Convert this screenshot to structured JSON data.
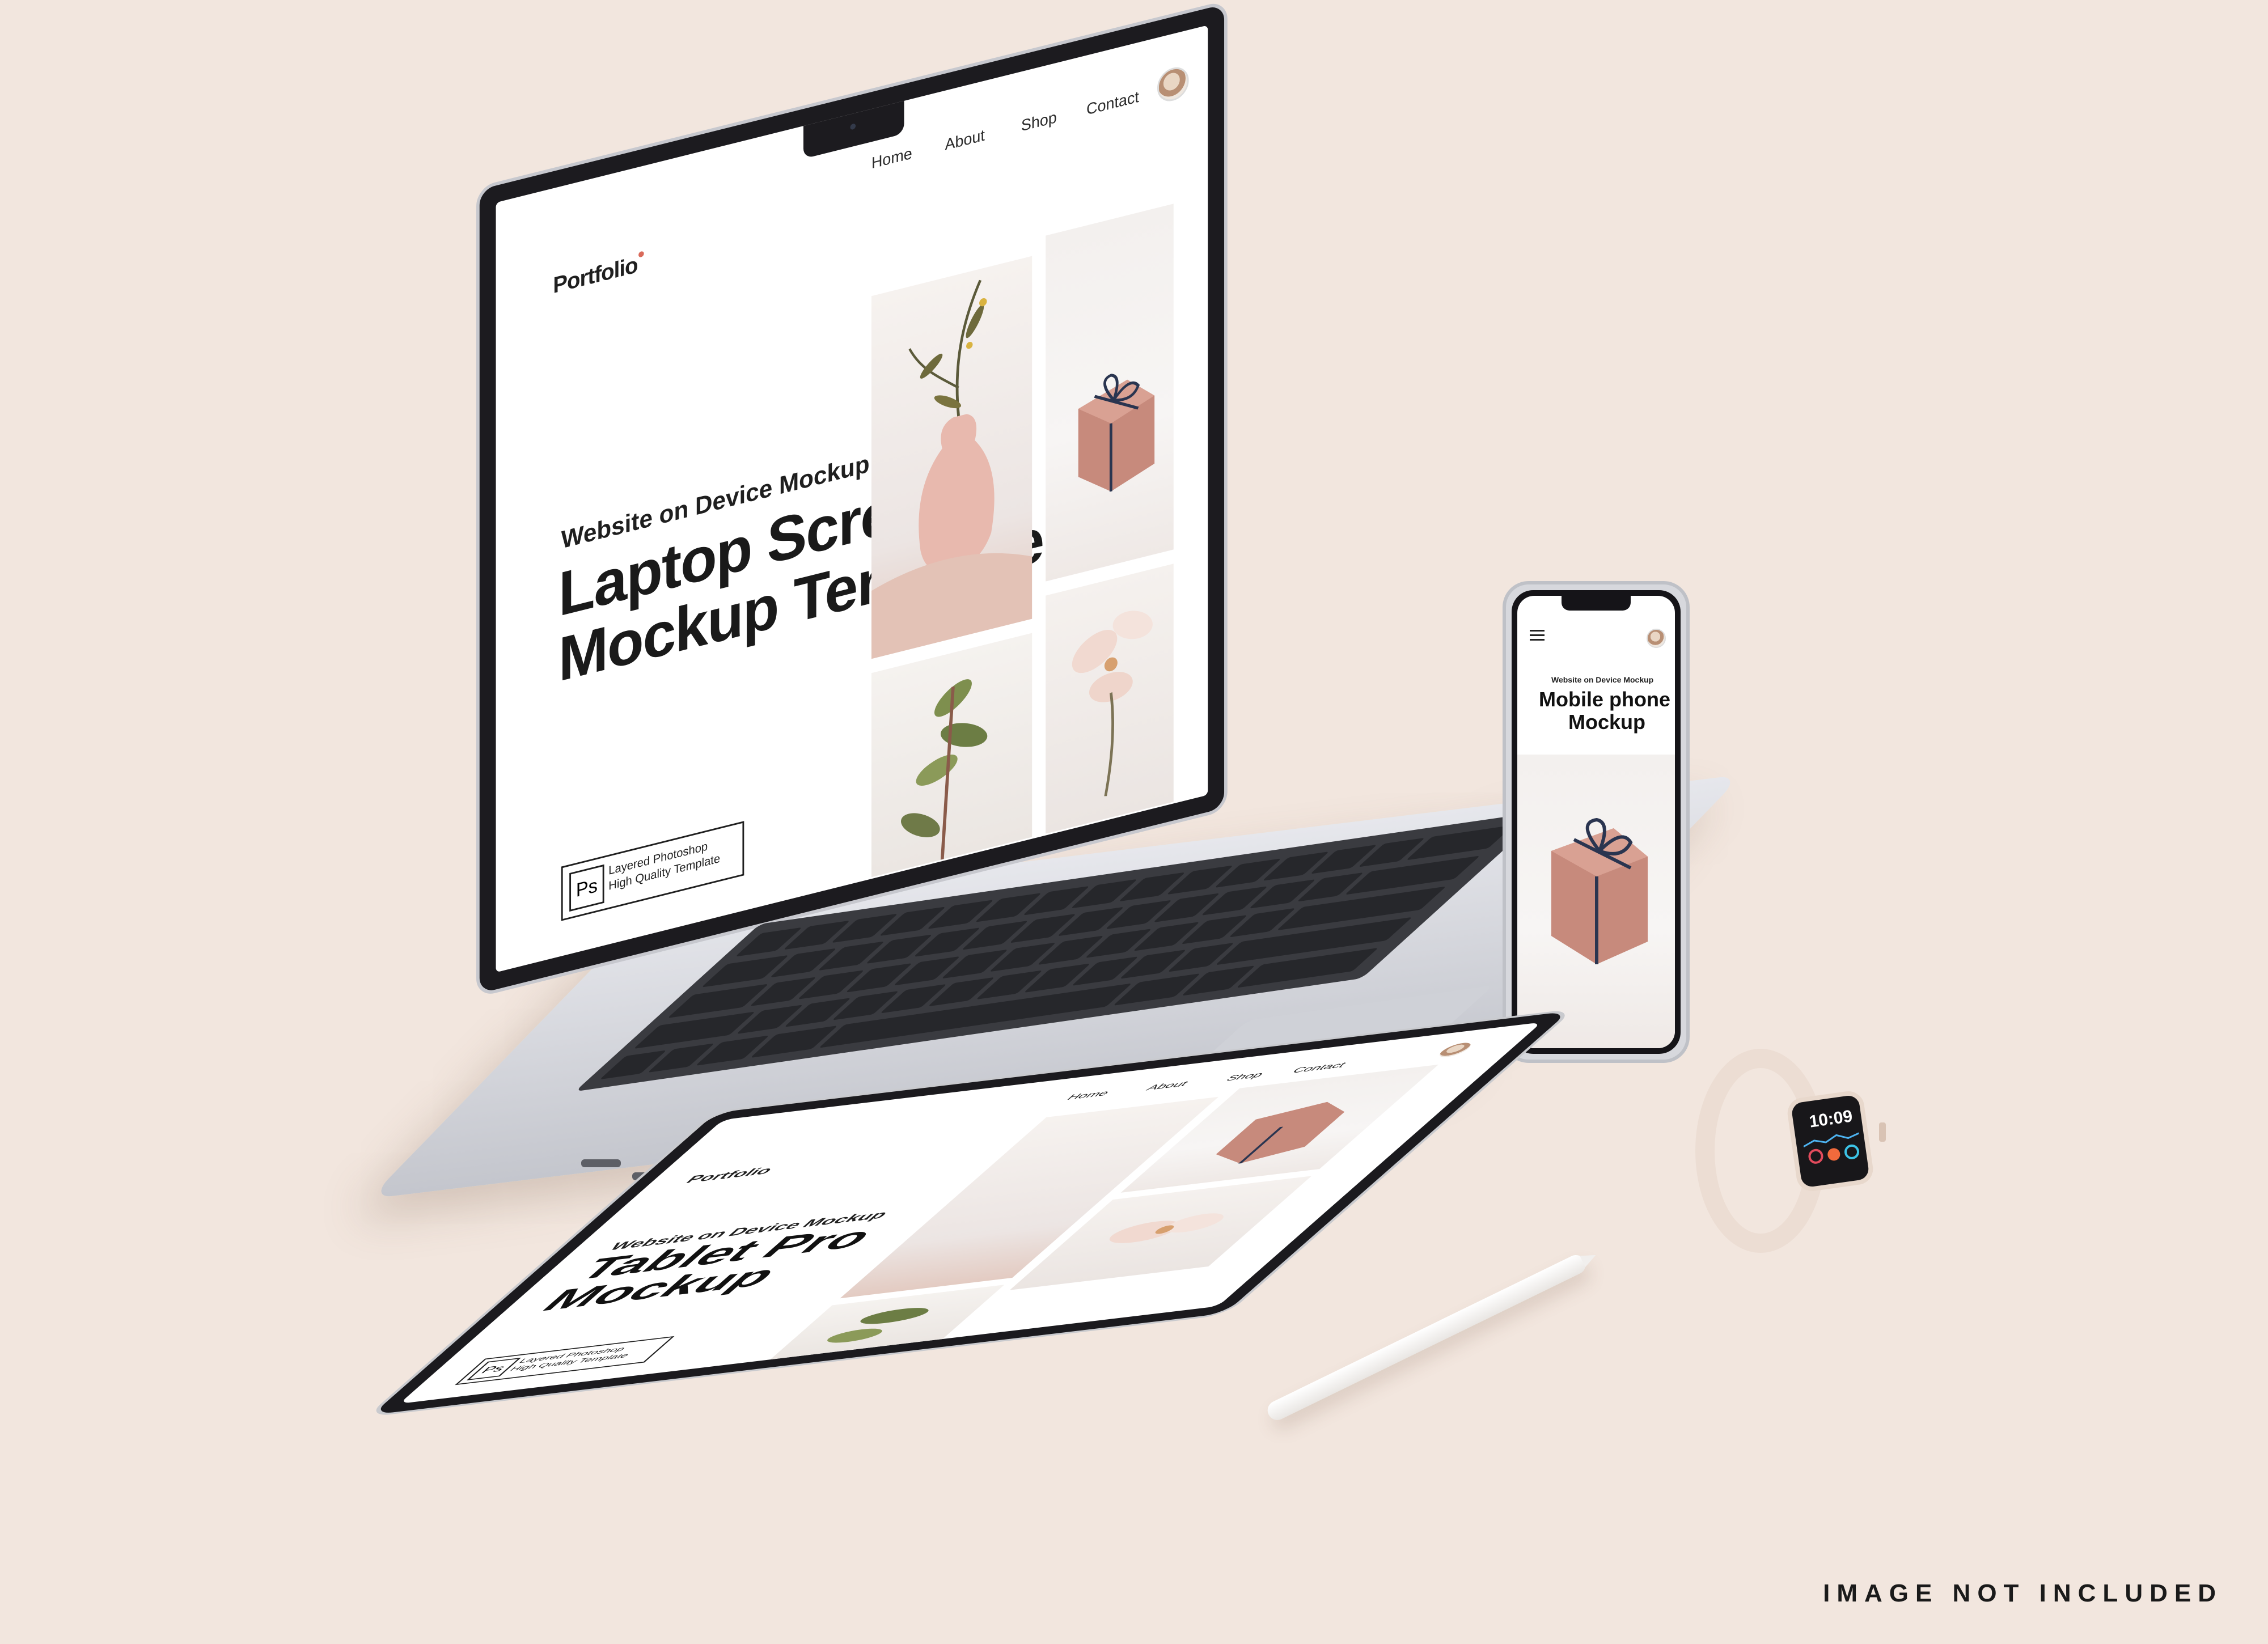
{
  "laptop": {
    "logo": "Portfolio",
    "nav": [
      "Home",
      "About",
      "Shop",
      "Contact"
    ],
    "hero_subtitle": "Website on Device Mockup",
    "hero_title_line1": "Laptop Screen",
    "hero_title_line2": "Mockup Template",
    "badge_icon": "Ps",
    "badge_line1": "Layered Photoshop",
    "badge_line2": "High Quality Template"
  },
  "phone": {
    "subtitle": "Website on Device Mockup",
    "title_line1": "Mobile phone",
    "title_line2": "Mockup",
    "menu_icon": "hamburger-icon"
  },
  "tablet": {
    "logo": "Portfolio",
    "nav": [
      "Home",
      "About",
      "Shop",
      "Contact"
    ],
    "subtitle": "Website on Device Mockup",
    "title_line1": "Tablet Pro",
    "title_line2": "Mockup",
    "badge_icon": "Ps",
    "badge_line1": "Layered Photoshop",
    "badge_line2": "High Quality Template"
  },
  "watch": {
    "time": "10:09"
  },
  "footer": {
    "note": "IMAGE NOT INCLUDED"
  },
  "colors": {
    "background": "#f2e6de",
    "accent_dot": "#d96a5a",
    "box_pink": "#c78a7c",
    "vase_pink": "#e8b9ae"
  }
}
